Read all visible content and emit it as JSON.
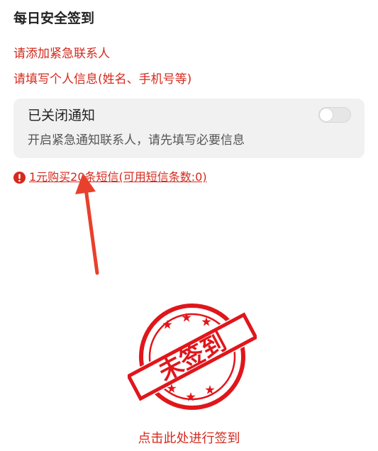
{
  "page": {
    "title": "每日安全签到"
  },
  "warnings": {
    "add_contact": "请添加紧急联系人",
    "fill_info": "请填写个人信息(姓名、手机号等)"
  },
  "notify_card": {
    "title": "已关闭通知",
    "description": "开启紧急通知联系人，请先填写必要信息",
    "toggle_on": false
  },
  "sms": {
    "link_text": "1元购买20条短信(可用短信条数:0)"
  },
  "stamp": {
    "text": "未签到"
  },
  "checkin": {
    "label": "点击此处进行签到"
  },
  "colors": {
    "accent_red": "#d42a1e",
    "stamp_red": "#e0161b",
    "arrow_red": "#e8402c",
    "card_bg": "#f1f1f1"
  }
}
